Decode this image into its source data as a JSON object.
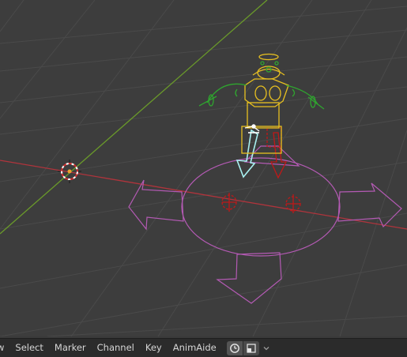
{
  "viewport": {
    "name": "3D Viewport"
  },
  "header": {
    "partial_menu": "w",
    "menus": [
      "Select",
      "Marker",
      "Channel",
      "Key",
      "AnimAide"
    ]
  },
  "icons": {
    "clock": "clock-icon",
    "overlay": "overlay-toggle-icon",
    "dropdown": "chevron-down-icon"
  },
  "colors": {
    "x_axis": "#b0343c",
    "y_axis": "#6a9a2a",
    "grid": "#4a4a4a",
    "rig_yellow": "#e8c020",
    "rig_green": "#2fa52f",
    "rig_purple": "#b45ab4",
    "rig_red": "#c01818",
    "rig_cyan": "#a8f0f0"
  }
}
